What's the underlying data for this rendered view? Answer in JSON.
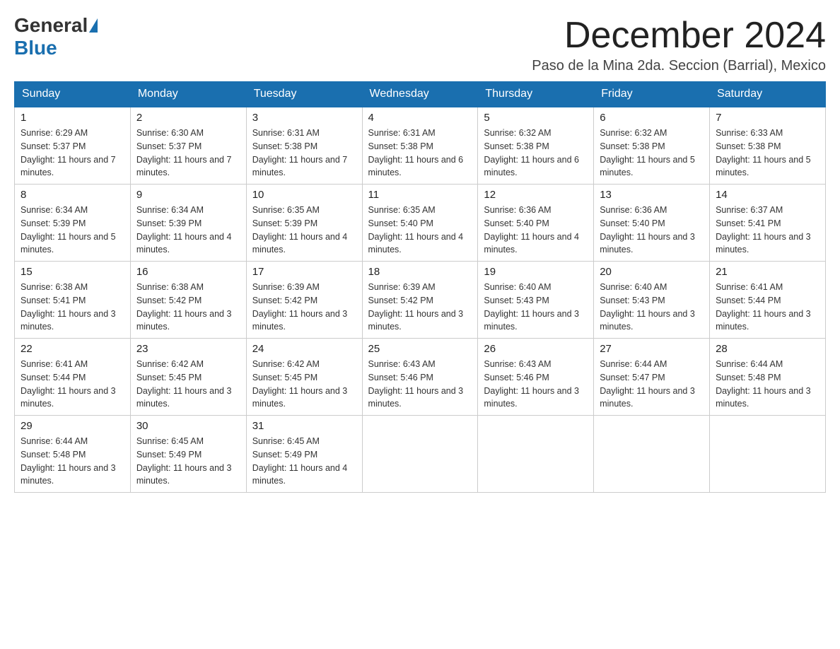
{
  "header": {
    "logo_general": "General",
    "logo_blue": "Blue",
    "month_title": "December 2024",
    "location": "Paso de la Mina 2da. Seccion (Barrial), Mexico"
  },
  "days_of_week": [
    "Sunday",
    "Monday",
    "Tuesday",
    "Wednesday",
    "Thursday",
    "Friday",
    "Saturday"
  ],
  "weeks": [
    [
      {
        "day": "1",
        "sunrise": "6:29 AM",
        "sunset": "5:37 PM",
        "daylight": "11 hours and 7 minutes."
      },
      {
        "day": "2",
        "sunrise": "6:30 AM",
        "sunset": "5:37 PM",
        "daylight": "11 hours and 7 minutes."
      },
      {
        "day": "3",
        "sunrise": "6:31 AM",
        "sunset": "5:38 PM",
        "daylight": "11 hours and 7 minutes."
      },
      {
        "day": "4",
        "sunrise": "6:31 AM",
        "sunset": "5:38 PM",
        "daylight": "11 hours and 6 minutes."
      },
      {
        "day": "5",
        "sunrise": "6:32 AM",
        "sunset": "5:38 PM",
        "daylight": "11 hours and 6 minutes."
      },
      {
        "day": "6",
        "sunrise": "6:32 AM",
        "sunset": "5:38 PM",
        "daylight": "11 hours and 5 minutes."
      },
      {
        "day": "7",
        "sunrise": "6:33 AM",
        "sunset": "5:38 PM",
        "daylight": "11 hours and 5 minutes."
      }
    ],
    [
      {
        "day": "8",
        "sunrise": "6:34 AM",
        "sunset": "5:39 PM",
        "daylight": "11 hours and 5 minutes."
      },
      {
        "day": "9",
        "sunrise": "6:34 AM",
        "sunset": "5:39 PM",
        "daylight": "11 hours and 4 minutes."
      },
      {
        "day": "10",
        "sunrise": "6:35 AM",
        "sunset": "5:39 PM",
        "daylight": "11 hours and 4 minutes."
      },
      {
        "day": "11",
        "sunrise": "6:35 AM",
        "sunset": "5:40 PM",
        "daylight": "11 hours and 4 minutes."
      },
      {
        "day": "12",
        "sunrise": "6:36 AM",
        "sunset": "5:40 PM",
        "daylight": "11 hours and 4 minutes."
      },
      {
        "day": "13",
        "sunrise": "6:36 AM",
        "sunset": "5:40 PM",
        "daylight": "11 hours and 3 minutes."
      },
      {
        "day": "14",
        "sunrise": "6:37 AM",
        "sunset": "5:41 PM",
        "daylight": "11 hours and 3 minutes."
      }
    ],
    [
      {
        "day": "15",
        "sunrise": "6:38 AM",
        "sunset": "5:41 PM",
        "daylight": "11 hours and 3 minutes."
      },
      {
        "day": "16",
        "sunrise": "6:38 AM",
        "sunset": "5:42 PM",
        "daylight": "11 hours and 3 minutes."
      },
      {
        "day": "17",
        "sunrise": "6:39 AM",
        "sunset": "5:42 PM",
        "daylight": "11 hours and 3 minutes."
      },
      {
        "day": "18",
        "sunrise": "6:39 AM",
        "sunset": "5:42 PM",
        "daylight": "11 hours and 3 minutes."
      },
      {
        "day": "19",
        "sunrise": "6:40 AM",
        "sunset": "5:43 PM",
        "daylight": "11 hours and 3 minutes."
      },
      {
        "day": "20",
        "sunrise": "6:40 AM",
        "sunset": "5:43 PM",
        "daylight": "11 hours and 3 minutes."
      },
      {
        "day": "21",
        "sunrise": "6:41 AM",
        "sunset": "5:44 PM",
        "daylight": "11 hours and 3 minutes."
      }
    ],
    [
      {
        "day": "22",
        "sunrise": "6:41 AM",
        "sunset": "5:44 PM",
        "daylight": "11 hours and 3 minutes."
      },
      {
        "day": "23",
        "sunrise": "6:42 AM",
        "sunset": "5:45 PM",
        "daylight": "11 hours and 3 minutes."
      },
      {
        "day": "24",
        "sunrise": "6:42 AM",
        "sunset": "5:45 PM",
        "daylight": "11 hours and 3 minutes."
      },
      {
        "day": "25",
        "sunrise": "6:43 AM",
        "sunset": "5:46 PM",
        "daylight": "11 hours and 3 minutes."
      },
      {
        "day": "26",
        "sunrise": "6:43 AM",
        "sunset": "5:46 PM",
        "daylight": "11 hours and 3 minutes."
      },
      {
        "day": "27",
        "sunrise": "6:44 AM",
        "sunset": "5:47 PM",
        "daylight": "11 hours and 3 minutes."
      },
      {
        "day": "28",
        "sunrise": "6:44 AM",
        "sunset": "5:48 PM",
        "daylight": "11 hours and 3 minutes."
      }
    ],
    [
      {
        "day": "29",
        "sunrise": "6:44 AM",
        "sunset": "5:48 PM",
        "daylight": "11 hours and 3 minutes."
      },
      {
        "day": "30",
        "sunrise": "6:45 AM",
        "sunset": "5:49 PM",
        "daylight": "11 hours and 3 minutes."
      },
      {
        "day": "31",
        "sunrise": "6:45 AM",
        "sunset": "5:49 PM",
        "daylight": "11 hours and 4 minutes."
      },
      null,
      null,
      null,
      null
    ]
  ]
}
